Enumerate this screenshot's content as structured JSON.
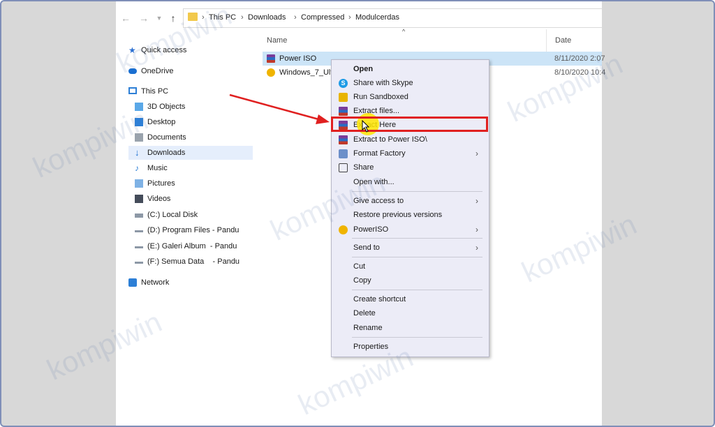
{
  "breadcrumb": [
    "This PC",
    "Downloads",
    "Compressed",
    "Modulcerdas"
  ],
  "sidebar": {
    "items": [
      {
        "label": "Quick access",
        "icon": "star-icon"
      },
      {
        "label": "OneDrive",
        "icon": "cloud-icon"
      },
      {
        "label": "This PC",
        "icon": "computer-icon"
      },
      {
        "label": "3D Objects",
        "icon": "cube-icon"
      },
      {
        "label": "Desktop",
        "icon": "desktop-icon"
      },
      {
        "label": "Documents",
        "icon": "documents-icon"
      },
      {
        "label": "Downloads",
        "icon": "download-arrow-icon"
      },
      {
        "label": "Music",
        "icon": "music-note-icon"
      },
      {
        "label": "Pictures",
        "icon": "pictures-icon"
      },
      {
        "label": "Videos",
        "icon": "videos-icon"
      },
      {
        "label": "(C:) Local Disk",
        "icon": "drive-icon"
      },
      {
        "label": "(D:) Program Files - Pandu",
        "icon": "drive-icon"
      },
      {
        "label": "(E:) Galeri Album  - Pandu",
        "icon": "drive-icon"
      },
      {
        "label": "(F:) Semua Data    - Pandu",
        "icon": "drive-icon"
      },
      {
        "label": "Network",
        "icon": "network-icon"
      }
    ],
    "selected": "Downloads"
  },
  "columns": {
    "name": "Name",
    "date": "Date"
  },
  "files": [
    {
      "name": "Power ISO",
      "date": "8/11/2020 2:07",
      "icon": "winrar-archive-icon"
    },
    {
      "name": "Windows_7_Ult",
      "date": "8/10/2020 10:4",
      "icon": "poweriso-disc-icon"
    }
  ],
  "context_menu": {
    "items": [
      {
        "label": "Open",
        "bold": true
      },
      {
        "label": "Share with Skype",
        "icon": "skype-icon"
      },
      {
        "label": "Run Sandboxed",
        "icon": "sandbox-icon"
      },
      {
        "label": "Extract files...",
        "icon": "winrar-icon"
      },
      {
        "label": "Extract Here",
        "icon": "winrar-icon",
        "highlighted": true
      },
      {
        "label": "Extract to Power ISO\\",
        "icon": "winrar-icon"
      },
      {
        "label": "Format Factory",
        "icon": "format-factory-icon",
        "submenu": true
      },
      {
        "label": "Share",
        "icon": "share-icon"
      },
      {
        "label": "Open with..."
      },
      {
        "label": "Give access to",
        "submenu": true
      },
      {
        "label": "Restore previous versions"
      },
      {
        "label": "PowerISO",
        "icon": "poweriso-icon",
        "submenu": true
      },
      {
        "label": "Send to",
        "submenu": true
      },
      {
        "label": "Cut"
      },
      {
        "label": "Copy"
      },
      {
        "label": "Create shortcut"
      },
      {
        "label": "Delete"
      },
      {
        "label": "Rename"
      },
      {
        "label": "Properties"
      }
    ]
  },
  "colors": {
    "highlight_border": "#e02020",
    "cursor_highlight": "#ffe600",
    "selection": "#cce4f7"
  },
  "watermark": "kompiwin"
}
